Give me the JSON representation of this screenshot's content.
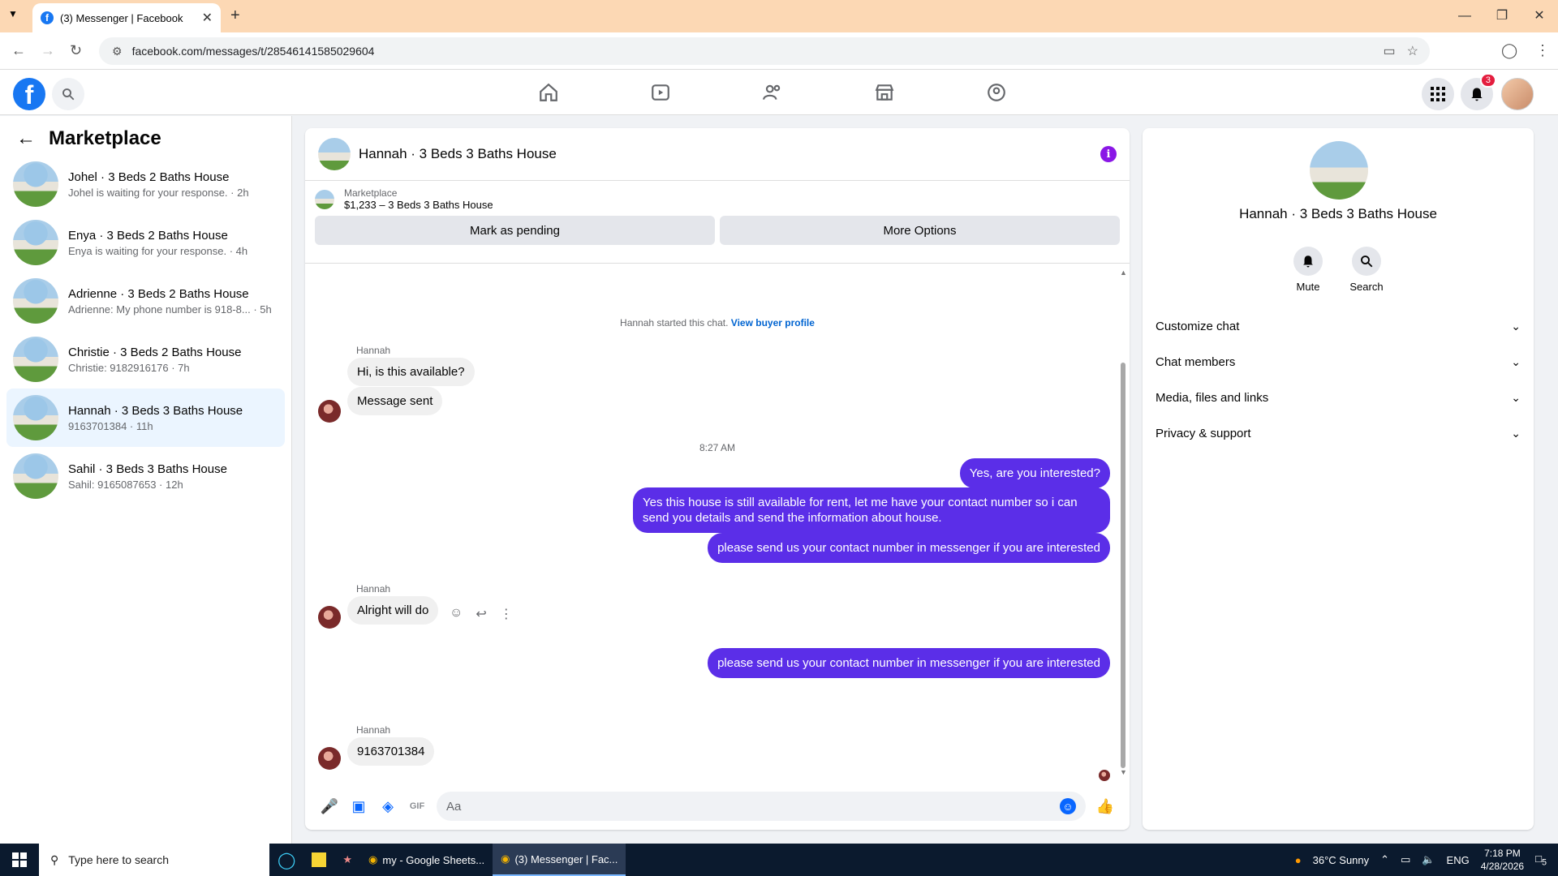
{
  "browser": {
    "tab_title": "(3) Messenger | Facebook",
    "url": "facebook.com/messages/t/28546141585029604"
  },
  "fbnav": {
    "notifications_count": "3"
  },
  "sidebar": {
    "title": "Marketplace",
    "conversations": [
      {
        "name": "Johel · 3 Beds 2 Baths House",
        "preview": "Johel is waiting for your response. · 2h",
        "active": false
      },
      {
        "name": "Enya · 3 Beds 2 Baths House",
        "preview": "Enya is waiting for your response. · 4h",
        "active": false
      },
      {
        "name": "Adrienne · 3 Beds 2 Baths House",
        "preview": "Adrienne: My phone number is 918-8... · 5h",
        "active": false
      },
      {
        "name": "Christie · 3 Beds 2 Baths House",
        "preview": "Christie: 9182916176 · 7h",
        "active": false
      },
      {
        "name": "Hannah · 3 Beds 3 Baths House",
        "preview": "9163701384 · 11h",
        "active": true
      },
      {
        "name": "Sahil · 3 Beds 3 Baths House",
        "preview": "Sahil: 9165087653 · 12h",
        "active": false
      }
    ]
  },
  "chat": {
    "title": "Hannah · 3 Beds 3 Baths House",
    "marketplace_label": "Marketplace",
    "listing": "$1,233 – 3 Beds 3 Baths House",
    "mark_pending": "Mark as pending",
    "more_options": "More Options",
    "system_text": "Hannah started this chat.",
    "view_buyer": "View buyer profile",
    "sender_name": "Hannah",
    "msg1": "Hi, is this available?",
    "msg2": "Message sent",
    "time": "8:27 AM",
    "out1": "Yes, are you interested?",
    "out2": "Yes this house is still available for rent, let me have your contact number so i can send you details and send the information about house.",
    "out3": "please  send us your contact number in messenger if you are interested",
    "msg3": "Alright will do",
    "out4": "please  send us your contact number in messenger if you are interested",
    "msg4": "9163701384",
    "composer_placeholder": "Aa"
  },
  "details": {
    "name": "Hannah · 3 Beds 3 Baths House",
    "mute": "Mute",
    "search": "Search",
    "sections": [
      "Customize chat",
      "Chat members",
      "Media, files and links",
      "Privacy & support"
    ]
  },
  "taskbar": {
    "search_placeholder": "Type here to search",
    "app1": "my - Google Sheets...",
    "app2": "(3) Messenger | Fac...",
    "weather": "36°C  Sunny",
    "lang": "ENG",
    "time": "7:18 PM",
    "date": "4/28/2026",
    "notif": "5"
  }
}
